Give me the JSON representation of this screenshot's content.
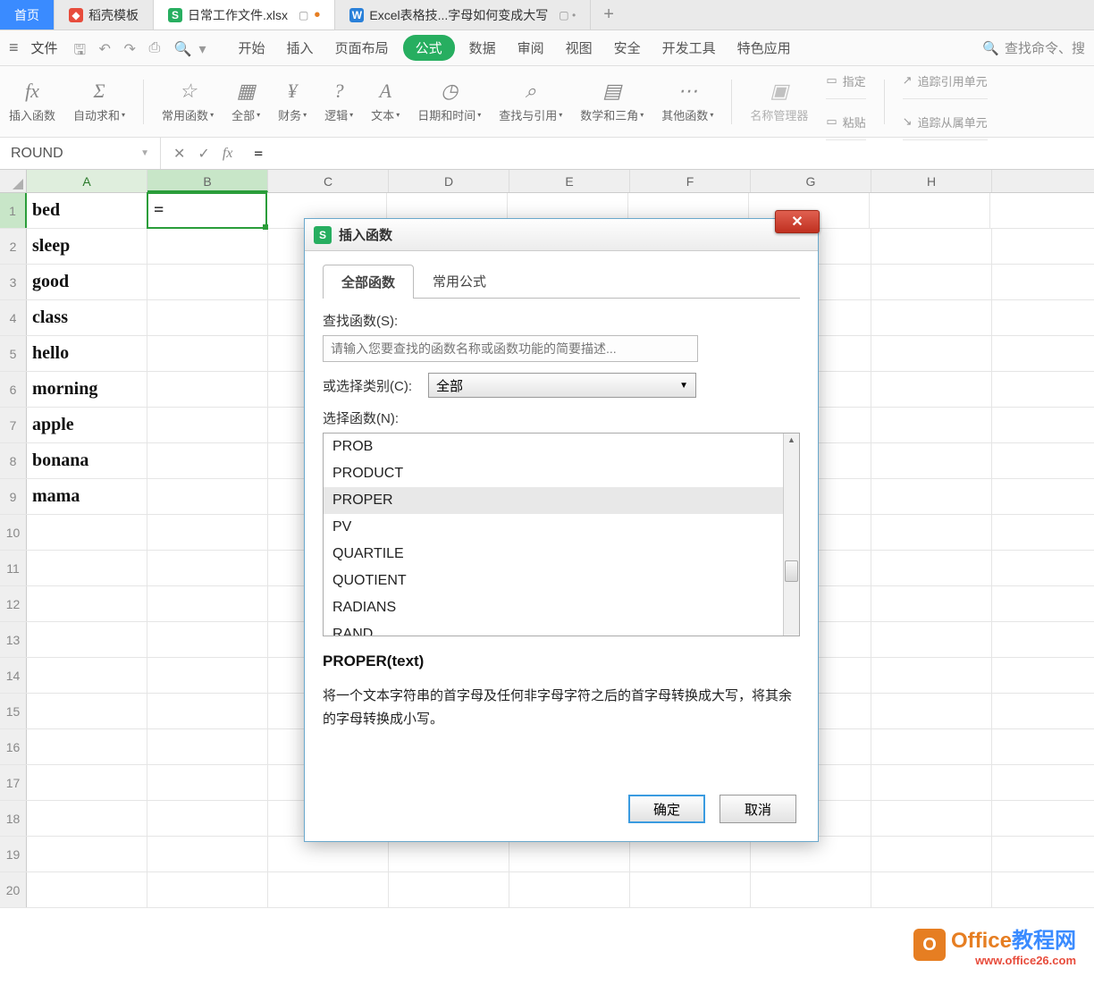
{
  "tabs": {
    "home": "首页",
    "t1": "稻壳模板",
    "t2": "日常工作文件.xlsx",
    "t3": "Excel表格技...字母如何变成大写"
  },
  "menubar": {
    "file": "文件",
    "items": [
      "开始",
      "插入",
      "页面布局",
      "公式",
      "数据",
      "审阅",
      "视图",
      "安全",
      "开发工具",
      "特色应用"
    ],
    "search": "查找命令、搜"
  },
  "ribbon": {
    "g0": "插入函数",
    "g1": "自动求和",
    "g2": "常用函数",
    "g3": "全部",
    "g4": "财务",
    "g5": "逻辑",
    "g6": "文本",
    "g7": "日期和时间",
    "g8": "查找与引用",
    "g9": "数学和三角",
    "g10": "其他函数",
    "g11": "名称管理器",
    "g12a": "指定",
    "g12b": "粘贴",
    "g13a": "追踪引用单元",
    "g13b": "追踪从属单元"
  },
  "formulaBar": {
    "name": "ROUND",
    "formula": "="
  },
  "columns": [
    "A",
    "B",
    "C",
    "D",
    "E",
    "F",
    "G",
    "H"
  ],
  "rows": [
    {
      "n": "1",
      "a": "bed",
      "b": "="
    },
    {
      "n": "2",
      "a": "sleep",
      "b": ""
    },
    {
      "n": "3",
      "a": "good",
      "b": ""
    },
    {
      "n": "4",
      "a": "class",
      "b": ""
    },
    {
      "n": "5",
      "a": "hello",
      "b": ""
    },
    {
      "n": "6",
      "a": "morning",
      "b": ""
    },
    {
      "n": "7",
      "a": "apple",
      "b": ""
    },
    {
      "n": "8",
      "a": "bonana",
      "b": ""
    },
    {
      "n": "9",
      "a": "mama",
      "b": ""
    },
    {
      "n": "10",
      "a": "",
      "b": ""
    },
    {
      "n": "11",
      "a": "",
      "b": ""
    },
    {
      "n": "12",
      "a": "",
      "b": ""
    },
    {
      "n": "13",
      "a": "",
      "b": ""
    },
    {
      "n": "14",
      "a": "",
      "b": ""
    },
    {
      "n": "15",
      "a": "",
      "b": ""
    },
    {
      "n": "16",
      "a": "",
      "b": ""
    },
    {
      "n": "17",
      "a": "",
      "b": ""
    },
    {
      "n": "18",
      "a": "",
      "b": ""
    },
    {
      "n": "19",
      "a": "",
      "b": ""
    },
    {
      "n": "20",
      "a": "",
      "b": ""
    }
  ],
  "dialog": {
    "title": "插入函数",
    "tab1": "全部函数",
    "tab2": "常用公式",
    "searchLbl": "查找函数(S):",
    "searchPh": "请输入您要查找的函数名称或函数功能的简要描述...",
    "catLbl": "或选择类别(C):",
    "catVal": "全部",
    "listLbl": "选择函数(N):",
    "list": [
      "PROB",
      "PRODUCT",
      "PROPER",
      "PV",
      "QUARTILE",
      "QUOTIENT",
      "RADIANS",
      "RAND"
    ],
    "selIdx": 2,
    "sig": "PROPER(text)",
    "desc": "将一个文本字符串的首字母及任何非字母字符之后的首字母转换成大写，将其余的字母转换成小写。",
    "ok": "确定",
    "cancel": "取消"
  },
  "watermark": {
    "brand1": "Office",
    "brand2": "教程网",
    "url": "www.office26.com"
  }
}
